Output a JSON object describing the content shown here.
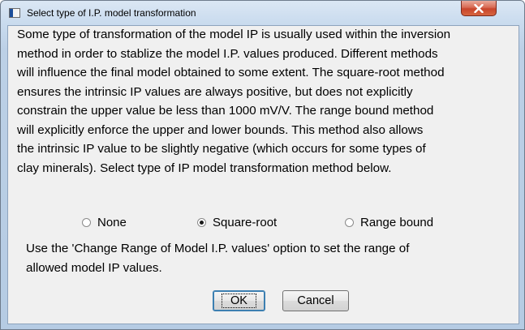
{
  "window": {
    "title": "Select type of I.P. model transformation",
    "close_icon": "close-x-icon",
    "app_icon": "dialog-app-icon"
  },
  "description": {
    "lines": [
      "Some type of transformation of the model IP is usually used within the inversion",
      "method in order to stablize the model I.P. values produced. Different methods",
      "will influence the final model obtained to some extent. The square-root method",
      "ensures the intrinsic IP values are always positive, but does not explicitly",
      "constrain the upper value be less than 1000 mV/V. The range bound method",
      "will explicitly enforce the upper and lower bounds. This method also allows",
      "the intrinsic IP value to be slightly negative (which occurs for some types of",
      "clay minerals). Select type of IP model transformation method below."
    ]
  },
  "options": {
    "selected": "Square-root",
    "items": [
      {
        "label": "None",
        "checked": false
      },
      {
        "label": "Square-root",
        "checked": true
      },
      {
        "label": "Range bound",
        "checked": false
      }
    ]
  },
  "note": {
    "lines": [
      "Use the 'Change Range of Model I.P. values' option to set the range of",
      "allowed model IP values."
    ]
  },
  "buttons": {
    "ok_label": "OK",
    "cancel_label": "Cancel"
  },
  "colors": {
    "close_button": "#c9452c",
    "default_button_border": "#3c7fb1",
    "client_background": "#f0f0f0"
  }
}
